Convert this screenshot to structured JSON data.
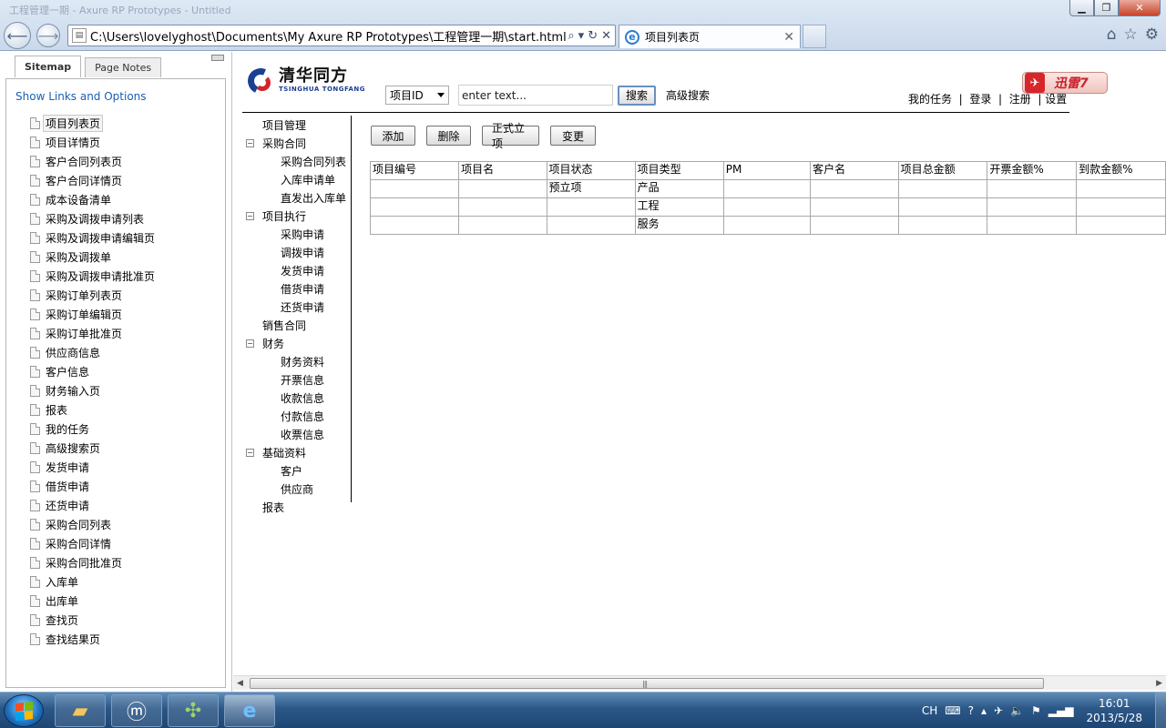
{
  "browser": {
    "title_faint": "工程管理一期 - Axure RP Prototypes - Untitled",
    "url": "C:\\Users\\lovelyghost\\Documents\\My Axure RP Prototypes\\工程管理一期\\start.html",
    "tab_label": "项目列表页",
    "address_icons": [
      "search-icon",
      "dropdown-icon",
      "refresh-icon",
      "stop-icon"
    ],
    "right_icons": [
      "home-icon",
      "star-icon",
      "gear-icon"
    ]
  },
  "left_pane": {
    "tabs": [
      {
        "label": "Sitemap",
        "active": true
      },
      {
        "label": "Page Notes",
        "active": false
      }
    ],
    "show_links": "Show Links and Options",
    "pages": [
      "项目列表页",
      "项目详情页",
      "客户合同列表页",
      "客户合同详情页",
      "成本设备清单",
      "采购及调拨申请列表",
      "采购及调拨申请编辑页",
      "采购及调拨单",
      "采购及调拨申请批准页",
      "采购订单列表页",
      "采购订单编辑页",
      "采购订单批准页",
      "供应商信息",
      "客户信息",
      "财务输入页",
      "报表",
      "我的任务",
      "高级搜索页",
      "发货申请",
      "借货申请",
      "还货申请",
      "采购合同列表",
      "采购合同详情",
      "采购合同批准页",
      "入库单",
      "出库单",
      "查找页",
      "查找结果页"
    ],
    "selected_index": 0
  },
  "header": {
    "logo_cn": "清华同方",
    "logo_en": "TSINGHUA TONGFANG",
    "search_field_selected": "项目ID",
    "search_placeholder": "enter text...",
    "search_button": "搜索",
    "advanced_search": "高级搜索",
    "xunlei_label": "迅雷7",
    "top_links": {
      "my_tasks": "我的任务",
      "login": "登录",
      "register": "注册",
      "settings": "设置",
      "separator": "|"
    }
  },
  "tree": [
    {
      "label": "项目管理",
      "level": 0,
      "toggle": ""
    },
    {
      "label": "采购合同",
      "level": 0,
      "toggle": "−"
    },
    {
      "label": "采购合同列表",
      "level": 1,
      "toggle": ""
    },
    {
      "label": "入库申请单",
      "level": 1,
      "toggle": ""
    },
    {
      "label": "直发出入库单",
      "level": 1,
      "toggle": ""
    },
    {
      "label": "项目执行",
      "level": 0,
      "toggle": "−"
    },
    {
      "label": "采购申请",
      "level": 1,
      "toggle": ""
    },
    {
      "label": "调拨申请",
      "level": 1,
      "toggle": ""
    },
    {
      "label": "发货申请",
      "level": 1,
      "toggle": ""
    },
    {
      "label": "借货申请",
      "level": 1,
      "toggle": ""
    },
    {
      "label": "还货申请",
      "level": 1,
      "toggle": ""
    },
    {
      "label": "销售合同",
      "level": 0,
      "toggle": ""
    },
    {
      "label": "财务",
      "level": 0,
      "toggle": "−"
    },
    {
      "label": "财务资料",
      "level": 1,
      "toggle": ""
    },
    {
      "label": "开票信息",
      "level": 1,
      "toggle": ""
    },
    {
      "label": "收款信息",
      "level": 1,
      "toggle": ""
    },
    {
      "label": "付款信息",
      "level": 1,
      "toggle": ""
    },
    {
      "label": "收票信息",
      "level": 1,
      "toggle": ""
    },
    {
      "label": "基础资料",
      "level": 0,
      "toggle": "−"
    },
    {
      "label": "客户",
      "level": 1,
      "toggle": ""
    },
    {
      "label": "供应商",
      "level": 1,
      "toggle": ""
    },
    {
      "label": "报表",
      "level": 0,
      "toggle": ""
    }
  ],
  "actions": {
    "add": "添加",
    "delete": "删除",
    "formal_project": "正式立项",
    "change": "变更"
  },
  "table": {
    "columns": [
      "项目编号",
      "项目名",
      "项目状态",
      "项目类型",
      "PM",
      "客户名",
      "项目总金额",
      "开票金额%",
      "到款金额%"
    ],
    "rows": [
      [
        "",
        "",
        "预立项",
        "产品",
        "",
        "",
        "",
        "",
        ""
      ],
      [
        "",
        "",
        "",
        "工程",
        "",
        "",
        "",
        "",
        ""
      ],
      [
        "",
        "",
        "",
        "服务",
        "",
        "",
        "",
        "",
        ""
      ]
    ]
  },
  "taskbar": {
    "apps": [
      "folder-icon",
      "maxthon-icon",
      "pinwheel-icon",
      "ie-icon"
    ],
    "input_lang": "CH",
    "time": "16:01",
    "date": "2013/5/28"
  },
  "colors": {
    "link_blue": "#1a5eb0",
    "logo_blue": "#1b3f93",
    "logo_red": "#d4242a",
    "taskbar": "#2b5787"
  }
}
